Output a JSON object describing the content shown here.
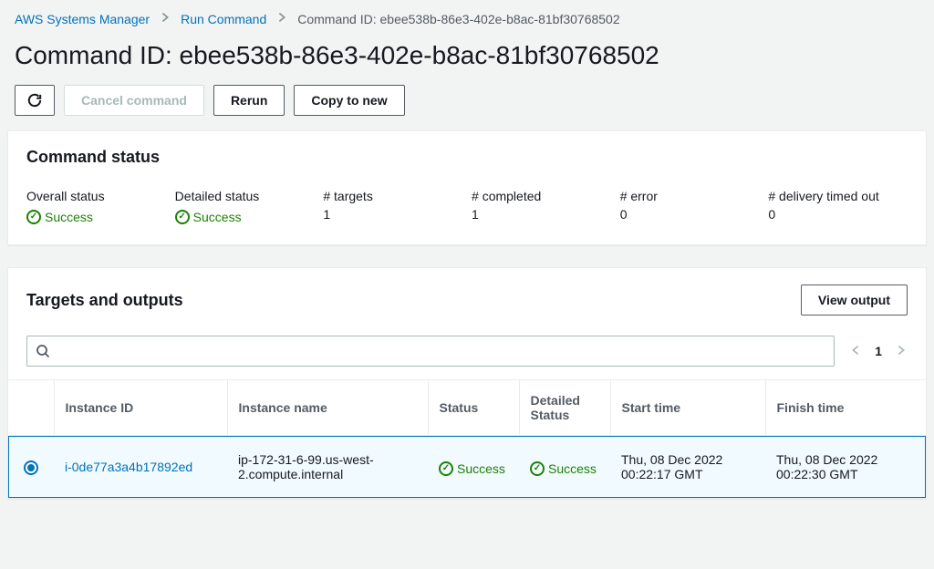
{
  "breadcrumb": {
    "items": [
      {
        "label": "AWS Systems Manager",
        "link": true
      },
      {
        "label": "Run Command",
        "link": true
      },
      {
        "label": "Command ID: ebee538b-86e3-402e-b8ac-81bf30768502",
        "link": false
      }
    ]
  },
  "page_title": "Command ID: ebee538b-86e3-402e-b8ac-81bf30768502",
  "toolbar": {
    "cancel_label": "Cancel command",
    "rerun_label": "Rerun",
    "copy_label": "Copy to new"
  },
  "command_status": {
    "heading": "Command status",
    "items": [
      {
        "label": "Overall status",
        "value": "Success",
        "success": true
      },
      {
        "label": "Detailed status",
        "value": "Success",
        "success": true
      },
      {
        "label": "# targets",
        "value": "1",
        "success": false
      },
      {
        "label": "# completed",
        "value": "1",
        "success": false
      },
      {
        "label": "# error",
        "value": "0",
        "success": false
      },
      {
        "label": "# delivery timed out",
        "value": "0",
        "success": false
      }
    ]
  },
  "targets": {
    "heading": "Targets and outputs",
    "view_output_label": "View output",
    "search_placeholder": "",
    "page": "1",
    "columns": [
      "Instance ID",
      "Instance name",
      "Status",
      "Detailed Status",
      "Start time",
      "Finish time"
    ],
    "rows": [
      {
        "selected": true,
        "instance_id": "i-0de77a3a4b17892ed",
        "instance_name": "ip-172-31-6-99.us-west-2.compute.internal",
        "status": "Success",
        "detailed_status": "Success",
        "start_time": "Thu, 08 Dec 2022 00:22:17 GMT",
        "finish_time": "Thu, 08 Dec 2022 00:22:30 GMT"
      }
    ]
  }
}
